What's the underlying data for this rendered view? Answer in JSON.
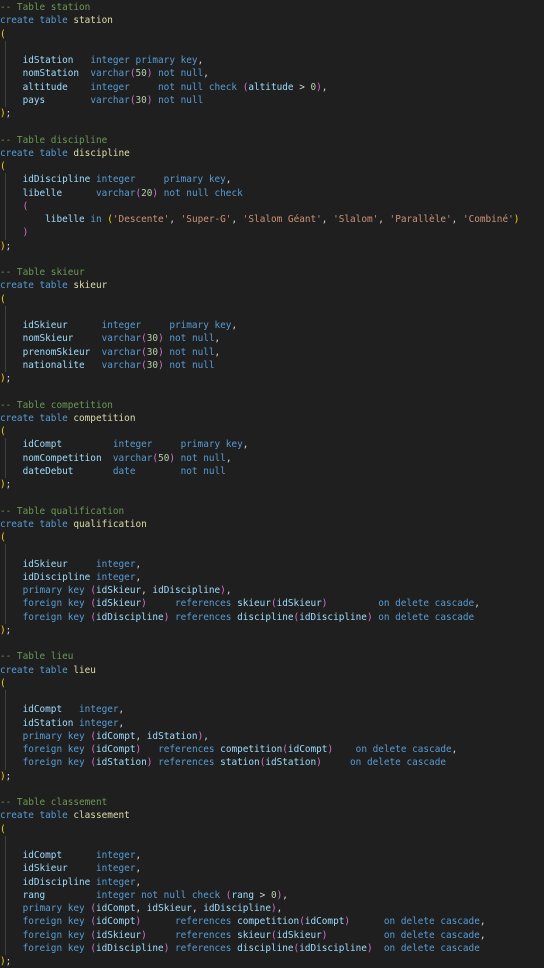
{
  "theme": {
    "background": "#1f1f1f",
    "comment": "#6a9955",
    "keyword": "#569cd6",
    "table_name": "#dcdcaa",
    "identifier": "#9cdcfe",
    "number": "#b5cea8",
    "string": "#ce9178",
    "paren_outer": "#ffd700",
    "paren_inner": "#da70d6"
  },
  "lines": [
    [
      [
        "comment",
        "-- Table station"
      ]
    ],
    [
      [
        "keyword",
        "create table "
      ],
      [
        "name",
        "station"
      ]
    ],
    [
      [
        "paren1",
        "("
      ]
    ],
    [],
    [
      [
        "ident",
        "    idStation   "
      ],
      [
        "keyword",
        "integer primary key"
      ],
      [
        "punct",
        ","
      ]
    ],
    [
      [
        "ident",
        "    nomStation  "
      ],
      [
        "keyword",
        "varchar"
      ],
      [
        "paren2",
        "("
      ],
      [
        "number",
        "50"
      ],
      [
        "paren2",
        ")"
      ],
      [
        "keyword",
        " not null"
      ],
      [
        "punct",
        ","
      ]
    ],
    [
      [
        "ident",
        "    altitude    "
      ],
      [
        "keyword",
        "integer     not null check "
      ],
      [
        "paren2",
        "("
      ],
      [
        "ident",
        "altitude "
      ],
      [
        "operator",
        "> "
      ],
      [
        "number",
        "0"
      ],
      [
        "paren2",
        ")"
      ],
      [
        "punct",
        ","
      ]
    ],
    [
      [
        "ident",
        "    pays        "
      ],
      [
        "keyword",
        "varchar"
      ],
      [
        "paren2",
        "("
      ],
      [
        "number",
        "30"
      ],
      [
        "paren2",
        ")"
      ],
      [
        "keyword",
        " not null"
      ]
    ],
    [
      [
        "paren1",
        ")"
      ],
      [
        "punct",
        ";"
      ]
    ],
    [],
    [
      [
        "comment",
        "-- Table discipline"
      ]
    ],
    [
      [
        "keyword",
        "create table "
      ],
      [
        "name",
        "discipline"
      ]
    ],
    [
      [
        "paren1",
        "("
      ]
    ],
    [
      [
        "ident",
        "    idDiscipline "
      ],
      [
        "keyword",
        "integer     primary key"
      ],
      [
        "punct",
        ","
      ]
    ],
    [
      [
        "ident",
        "    libelle      "
      ],
      [
        "keyword",
        "varchar"
      ],
      [
        "paren2",
        "("
      ],
      [
        "number",
        "20"
      ],
      [
        "paren2",
        ")"
      ],
      [
        "keyword",
        " not null check"
      ]
    ],
    [
      [
        "paren2",
        "    ("
      ]
    ],
    [
      [
        "ident",
        "        libelle "
      ],
      [
        "keyword",
        "in "
      ],
      [
        "paren1",
        "("
      ],
      [
        "string",
        "'Descente'"
      ],
      [
        "punct",
        ", "
      ],
      [
        "string",
        "'Super-G'"
      ],
      [
        "punct",
        ", "
      ],
      [
        "string",
        "'Slalom Géant'"
      ],
      [
        "punct",
        ", "
      ],
      [
        "string",
        "'Slalom'"
      ],
      [
        "punct",
        ", "
      ],
      [
        "string",
        "'Parallèle'"
      ],
      [
        "punct",
        ", "
      ],
      [
        "string",
        "'Combiné'"
      ],
      [
        "paren1",
        ")"
      ]
    ],
    [
      [
        "paren2",
        "    )"
      ]
    ],
    [
      [
        "paren1",
        ")"
      ],
      [
        "punct",
        ";"
      ]
    ],
    [],
    [
      [
        "comment",
        "-- Table skieur"
      ]
    ],
    [
      [
        "keyword",
        "create table "
      ],
      [
        "name",
        "skieur"
      ]
    ],
    [
      [
        "paren1",
        "("
      ]
    ],
    [],
    [
      [
        "ident",
        "    idSkieur      "
      ],
      [
        "keyword",
        "integer     primary key"
      ],
      [
        "punct",
        ","
      ]
    ],
    [
      [
        "ident",
        "    nomSkieur     "
      ],
      [
        "keyword",
        "varchar"
      ],
      [
        "paren2",
        "("
      ],
      [
        "number",
        "30"
      ],
      [
        "paren2",
        ")"
      ],
      [
        "keyword",
        " not null"
      ],
      [
        "punct",
        ","
      ]
    ],
    [
      [
        "ident",
        "    prenomSkieur  "
      ],
      [
        "keyword",
        "varchar"
      ],
      [
        "paren2",
        "("
      ],
      [
        "number",
        "30"
      ],
      [
        "paren2",
        ")"
      ],
      [
        "keyword",
        " not null"
      ],
      [
        "punct",
        ","
      ]
    ],
    [
      [
        "ident",
        "    nationalite   "
      ],
      [
        "keyword",
        "varchar"
      ],
      [
        "paren2",
        "("
      ],
      [
        "number",
        "30"
      ],
      [
        "paren2",
        ")"
      ],
      [
        "keyword",
        " not null"
      ]
    ],
    [
      [
        "paren1",
        ")"
      ],
      [
        "punct",
        ";"
      ]
    ],
    [],
    [
      [
        "comment",
        "-- Table competition"
      ]
    ],
    [
      [
        "keyword",
        "create table "
      ],
      [
        "name",
        "competition"
      ]
    ],
    [
      [
        "paren1",
        "("
      ]
    ],
    [
      [
        "ident",
        "    idCompt         "
      ],
      [
        "keyword",
        "integer     primary key"
      ],
      [
        "punct",
        ","
      ]
    ],
    [
      [
        "ident",
        "    nomCompetition  "
      ],
      [
        "keyword",
        "varchar"
      ],
      [
        "paren2",
        "("
      ],
      [
        "number",
        "50"
      ],
      [
        "paren2",
        ")"
      ],
      [
        "keyword",
        " not null"
      ],
      [
        "punct",
        ","
      ]
    ],
    [
      [
        "ident",
        "    dateDebut       "
      ],
      [
        "keyword",
        "date        not null"
      ]
    ],
    [
      [
        "paren1",
        ")"
      ],
      [
        "punct",
        ";"
      ]
    ],
    [],
    [
      [
        "comment",
        "-- Table qualification"
      ]
    ],
    [
      [
        "keyword",
        "create table "
      ],
      [
        "name",
        "qualification"
      ]
    ],
    [
      [
        "paren1",
        "("
      ]
    ],
    [],
    [
      [
        "ident",
        "    idSkieur     "
      ],
      [
        "keyword",
        "integer"
      ],
      [
        "punct",
        ","
      ]
    ],
    [
      [
        "ident",
        "    idDiscipline "
      ],
      [
        "keyword",
        "integer"
      ],
      [
        "punct",
        ","
      ]
    ],
    [
      [
        "keyword",
        "    primary key "
      ],
      [
        "paren2",
        "("
      ],
      [
        "ident",
        "idSkieur"
      ],
      [
        "punct",
        ", "
      ],
      [
        "ident",
        "idDiscipline"
      ],
      [
        "paren2",
        ")"
      ],
      [
        "punct",
        ","
      ]
    ],
    [
      [
        "keyword",
        "    foreign key "
      ],
      [
        "paren2",
        "("
      ],
      [
        "ident",
        "idSkieur"
      ],
      [
        "paren2",
        ")"
      ],
      [
        "keyword",
        "     references "
      ],
      [
        "ident",
        "skieur"
      ],
      [
        "paren2",
        "("
      ],
      [
        "ident",
        "idSkieur"
      ],
      [
        "paren2",
        ")"
      ],
      [
        "keyword",
        "         on delete cascade"
      ],
      [
        "punct",
        ","
      ]
    ],
    [
      [
        "keyword",
        "    foreign key "
      ],
      [
        "paren2",
        "("
      ],
      [
        "ident",
        "idDiscipline"
      ],
      [
        "paren2",
        ")"
      ],
      [
        "keyword",
        " references "
      ],
      [
        "ident",
        "discipline"
      ],
      [
        "paren2",
        "("
      ],
      [
        "ident",
        "idDiscipline"
      ],
      [
        "paren2",
        ")"
      ],
      [
        "keyword",
        " on delete cascade"
      ]
    ],
    [
      [
        "paren1",
        ")"
      ],
      [
        "punct",
        ";"
      ]
    ],
    [],
    [
      [
        "comment",
        "-- Table lieu"
      ]
    ],
    [
      [
        "keyword",
        "create table "
      ],
      [
        "name",
        "lieu"
      ]
    ],
    [
      [
        "paren1",
        "("
      ]
    ],
    [],
    [
      [
        "ident",
        "    idCompt   "
      ],
      [
        "keyword",
        "integer"
      ],
      [
        "punct",
        ","
      ]
    ],
    [
      [
        "ident",
        "    idStation "
      ],
      [
        "keyword",
        "integer"
      ],
      [
        "punct",
        ","
      ]
    ],
    [
      [
        "keyword",
        "    primary key "
      ],
      [
        "paren2",
        "("
      ],
      [
        "ident",
        "idCompt"
      ],
      [
        "punct",
        ", "
      ],
      [
        "ident",
        "idStation"
      ],
      [
        "paren2",
        ")"
      ],
      [
        "punct",
        ","
      ]
    ],
    [
      [
        "keyword",
        "    foreign key "
      ],
      [
        "paren2",
        "("
      ],
      [
        "ident",
        "idCompt"
      ],
      [
        "paren2",
        ")"
      ],
      [
        "keyword",
        "   references "
      ],
      [
        "ident",
        "competition"
      ],
      [
        "paren2",
        "("
      ],
      [
        "ident",
        "idCompt"
      ],
      [
        "paren2",
        ")"
      ],
      [
        "keyword",
        "    on delete cascade"
      ],
      [
        "punct",
        ","
      ]
    ],
    [
      [
        "keyword",
        "    foreign key "
      ],
      [
        "paren2",
        "("
      ],
      [
        "ident",
        "idStation"
      ],
      [
        "paren2",
        ")"
      ],
      [
        "keyword",
        " references "
      ],
      [
        "ident",
        "station"
      ],
      [
        "paren2",
        "("
      ],
      [
        "ident",
        "idStation"
      ],
      [
        "paren2",
        ")"
      ],
      [
        "keyword",
        "     on delete cascade"
      ]
    ],
    [
      [
        "paren1",
        ")"
      ],
      [
        "punct",
        ";"
      ]
    ],
    [],
    [
      [
        "comment",
        "-- Table classement"
      ]
    ],
    [
      [
        "keyword",
        "create table "
      ],
      [
        "name",
        "classement"
      ]
    ],
    [
      [
        "paren1",
        "("
      ]
    ],
    [],
    [
      [
        "ident",
        "    idCompt      "
      ],
      [
        "keyword",
        "integer"
      ],
      [
        "punct",
        ","
      ]
    ],
    [
      [
        "ident",
        "    idSkieur     "
      ],
      [
        "keyword",
        "integer"
      ],
      [
        "punct",
        ","
      ]
    ],
    [
      [
        "ident",
        "    idDiscipline "
      ],
      [
        "keyword",
        "integer"
      ],
      [
        "punct",
        ","
      ]
    ],
    [
      [
        "ident",
        "    rang         "
      ],
      [
        "keyword",
        "integer not null check "
      ],
      [
        "paren2",
        "("
      ],
      [
        "ident",
        "rang "
      ],
      [
        "operator",
        "> "
      ],
      [
        "number",
        "0"
      ],
      [
        "paren2",
        ")"
      ],
      [
        "punct",
        ","
      ]
    ],
    [
      [
        "keyword",
        "    primary key "
      ],
      [
        "paren2",
        "("
      ],
      [
        "ident",
        "idCompt"
      ],
      [
        "punct",
        ", "
      ],
      [
        "ident",
        "idSkieur"
      ],
      [
        "punct",
        ", "
      ],
      [
        "ident",
        "idDiscipline"
      ],
      [
        "paren2",
        ")"
      ],
      [
        "punct",
        ","
      ]
    ],
    [
      [
        "keyword",
        "    foreign key "
      ],
      [
        "paren2",
        "("
      ],
      [
        "ident",
        "idCompt"
      ],
      [
        "paren2",
        ")"
      ],
      [
        "keyword",
        "      references "
      ],
      [
        "ident",
        "competition"
      ],
      [
        "paren2",
        "("
      ],
      [
        "ident",
        "idCompt"
      ],
      [
        "paren2",
        ")"
      ],
      [
        "keyword",
        "      on delete cascade"
      ],
      [
        "punct",
        ","
      ]
    ],
    [
      [
        "keyword",
        "    foreign key "
      ],
      [
        "paren2",
        "("
      ],
      [
        "ident",
        "idSkieur"
      ],
      [
        "paren2",
        ")"
      ],
      [
        "keyword",
        "     references "
      ],
      [
        "ident",
        "skieur"
      ],
      [
        "paren2",
        "("
      ],
      [
        "ident",
        "idSkieur"
      ],
      [
        "paren2",
        ")"
      ],
      [
        "keyword",
        "          on delete cascade"
      ],
      [
        "punct",
        ","
      ]
    ],
    [
      [
        "keyword",
        "    foreign key "
      ],
      [
        "paren2",
        "("
      ],
      [
        "ident",
        "idDiscipline"
      ],
      [
        "paren2",
        ")"
      ],
      [
        "keyword",
        " references "
      ],
      [
        "ident",
        "discipline"
      ],
      [
        "paren2",
        "("
      ],
      [
        "ident",
        "idDiscipline"
      ],
      [
        "paren2",
        ")"
      ],
      [
        "keyword",
        "  on delete cascade"
      ]
    ],
    [
      [
        "paren1",
        ")"
      ],
      [
        "punct",
        ";"
      ]
    ]
  ]
}
